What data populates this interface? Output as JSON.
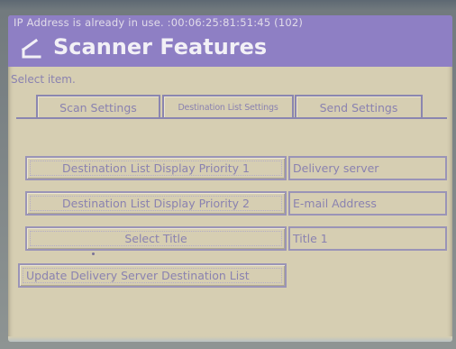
{
  "status": {
    "message": "IP Address is already in use. :00:06:25:81:51:45 (102)"
  },
  "header": {
    "title": "Scanner Features",
    "icon": "scanner-icon"
  },
  "instruction": "Select item.",
  "tabs": [
    {
      "label": "Scan Settings",
      "selected": false
    },
    {
      "label": "Destination List Settings",
      "selected": true
    },
    {
      "label": "Send Settings",
      "selected": false
    }
  ],
  "rows": [
    {
      "button": "Destination List Display Priority 1",
      "value": "Delivery server"
    },
    {
      "button": "Destination List Display Priority 2",
      "value": "E-mail Address"
    },
    {
      "button": "Select Title",
      "value": "Title 1"
    },
    {
      "button": "Update Delivery Server Destination List"
    }
  ],
  "colors": {
    "screen_background": "#d6ceb2",
    "header_background": "#8e7fc4",
    "text": "#8a82b0",
    "border": "#9a94b7"
  }
}
